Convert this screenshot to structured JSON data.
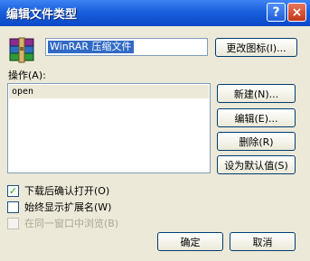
{
  "window": {
    "title": "编辑文件类型",
    "help_symbol": "?",
    "close_symbol": "×"
  },
  "file_type": {
    "icon": "winrar-archive-icon",
    "name": "WinRAR 压缩文件",
    "change_icon_label": "更改图标(I)..."
  },
  "actions": {
    "label": "操作(A):",
    "items": [
      "open"
    ],
    "new_label": "新建(N)...",
    "edit_label": "编辑(E)...",
    "remove_label": "删除(R)",
    "default_label": "设为默认值(S)"
  },
  "options": {
    "confirm_open": {
      "label": "下载后确认打开(O)",
      "checked": true,
      "check_mark": "✓"
    },
    "show_ext": {
      "label": "始终显示扩展名(W)",
      "checked": false
    },
    "same_window": {
      "label": "在同一窗口中浏览(B)",
      "checked": false,
      "disabled": true
    }
  },
  "footer": {
    "ok_label": "确定",
    "cancel_label": "取消"
  }
}
